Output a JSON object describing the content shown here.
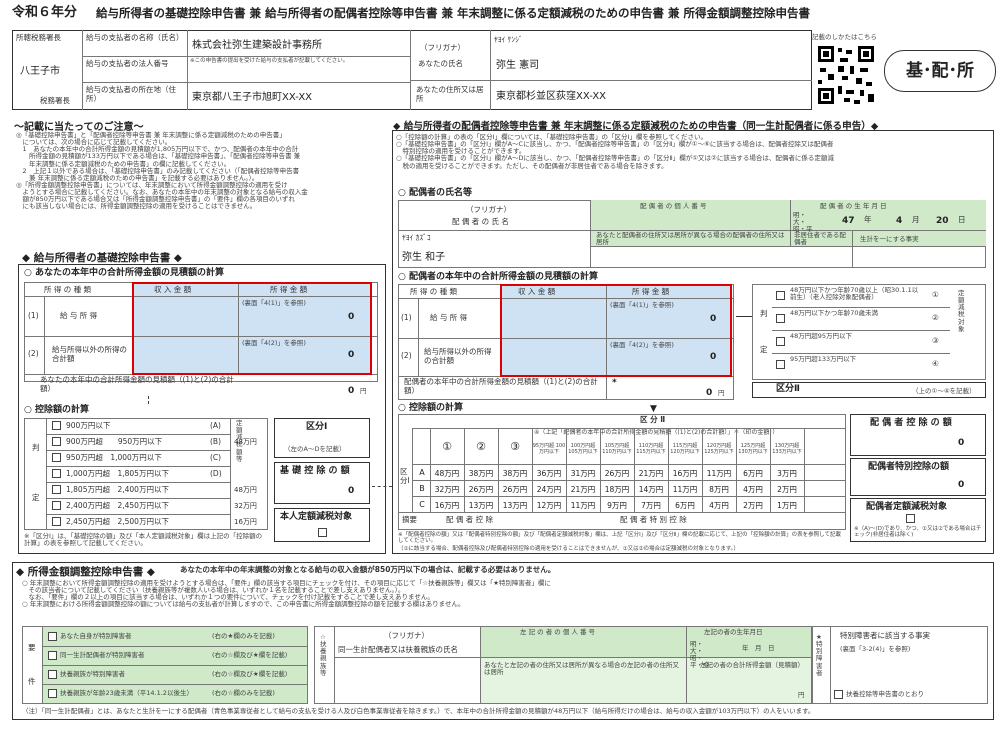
{
  "header": {
    "year": "令和６年分",
    "title": "給与所得者の基礎控除申告書 兼 給与所得者の配偶者控除等申告書 兼 年末調整に係る定額減税のための申告書 兼 所得金額調整控除申告書",
    "tax_office": "所轄税務署長",
    "tax_office_value": "八王子市",
    "tax_office_suffix": "税務署長",
    "payer_name_label": "給与の支払者の名称（氏名）",
    "payer_name": "株式会社弥生建築設計事務所",
    "payer_number_label": "給与の支払者の法人番号",
    "payer_number_note": "※この申告書の提出を受けた給与の支払者が記載してください。",
    "payer_address_label": "給与の支払者の所在地（住所）",
    "payer_address": "東京都八王子市旭町XX-XX",
    "furigana_label": "（フリガナ）",
    "name_label": "あなたの氏名",
    "furigana": "ﾔﾖｲ ｹﾝｼﾞ",
    "name": "弥生 憲司",
    "address_label": "あなたの住所又は居所",
    "address": "東京都杉並区荻窪XX-XX",
    "qr_caption": "記載のしかたはこちら",
    "badge": "基･配･所"
  },
  "notes": {
    "title": "～記載に当たってのご注意～",
    "lines": [
      "◎「基礎控除申告書」と「配偶者控除等申告書 兼 年末調整に係る定額減税のための申告書」",
      "　については、次の場合に応じて記載してください。",
      "　1　あなたの本年中の合計所得金額の見積額が1,805万円以下で、かつ、配偶者の本年中の合計",
      "　　所得金額の見積額が133万円以下である場合は、「基礎控除申告書」、「配偶者控除等申告書 兼",
      "　　年末調整に係る定額減税のための申告書」の欄に記載してください。",
      "　2　上記１以外である場合は、「基礎控除申告書」のみ記載してください（「配偶者控除等申告書",
      "　　兼 年末調整に係る定額減税のための申告書」を記載する必要はありません。）。",
      "◎「所得金額調整控除申告書」については、年末調整において所得金額調整控除の適用を受け",
      "　ようとする場合に記載してください。なお、あなたの本年中の年末調整の対象となる給与の収入金",
      "　額が850万円以下である場合又は「所得金額調整控除申告書」の「要件」欄の各項目のいずれ",
      "　にも該当しない場合には、所得金額調整控除の適用を受けることはできません。"
    ]
  },
  "basic": {
    "title": "◆ 給与所得者の基礎控除申告書 ◆",
    "income_section": "○ あなたの本年中の合計所得金額の見積額の計算",
    "col_type": "所 得 の 種 類",
    "col_revenue": "収 入 金 額",
    "col_income": "所 得 金 額",
    "row1_num": "(1)",
    "row1_label": "給 与 所 得",
    "row1_ref": "(裏面「4(1)」を参照)",
    "row1_value": "0",
    "row2_num": "(2)",
    "row2_label": "給与所得以外の所得の合計額",
    "row2_ref": "(裏面「4(2)」を参照)",
    "row2_value": "0",
    "total_label": "あなたの本年中の合計所得金額の見積額（(1)と(2)の合計額）",
    "total_value": "0",
    "yen": "円",
    "deduction_section": "○ 控除額の計算",
    "judge_top": "判",
    "judge_bottom": "定",
    "rows": [
      {
        "range": "900万円以下",
        "code": "(A)",
        "amt": ""
      },
      {
        "range": "900万円超　　950万円以下",
        "code": "(B)",
        "amt": "48万円"
      },
      {
        "range": "950万円超　1,000万円以下",
        "code": "(C)",
        "amt": ""
      },
      {
        "range": "1,000万円超　1,805万円以下",
        "code": "(D)",
        "amt": ""
      },
      {
        "range": "1,805万円超　2,400万円以下",
        "code": "",
        "amt": "48万円"
      },
      {
        "range": "2,400万円超　2,450万円以下",
        "code": "",
        "amt": "32万円"
      },
      {
        "range": "2,450万円超　2,500万円以下",
        "code": "",
        "amt": "16万円"
      }
    ],
    "col_reduction": "定額減税額等",
    "category_label": "区分Ⅰ",
    "category_note": "（左のA～Dを記載）",
    "basic_deduction_label": "基 礎 控 除 の 額",
    "basic_deduction_value": "0",
    "self_reduction_label": "本人定額減税対象",
    "footnote": "※「区分Ⅰ」は、「基礎控除の額」及び「本人定額減税対象」欄は上記の「控除額の計算」の表を参照して記載してください。"
  },
  "spouse": {
    "title": "◆ 給与所得者の配偶者控除等申告書 兼 年末調整に係る定額減税のための申告書（同一生計配偶者に係る申告）◆",
    "notes": [
      "○「控除額の計算」の表の「区分Ⅰ」欄については、「基礎控除申告書」の「区分Ⅰ」欄を参照してください。",
      "○「基礎控除申告書」の「区分Ⅰ」欄がA～Cに該当し、かつ、「配偶者控除等申告書」の「区分Ⅱ」欄が①～⑥に該当する場合は、配偶者控除又は配偶者",
      "　特別控除の適用を受けることができます。",
      "○「基礎控除申告書」の「区分Ⅰ」欄がA～Dに該当し、かつ、「配偶者控除等申告書」の「区分Ⅱ」欄が①又は②に該当する場合は、配偶者に係る定額減",
      "　税の適用を受けることができます。ただし、その配偶者が非居住者である場合を除きます。"
    ],
    "name_section": "○ 配偶者の氏名等",
    "furigana_label": "（フリガナ）",
    "name_label": "配 偶 者 の 氏 名",
    "personal_number_label": "配 偶 者 の 個 人 番 号",
    "birth_label": "配 偶 者 の 生 年 月 日",
    "era": "明・大・昭・平",
    "birth_year": "47",
    "year_unit": "年",
    "birth_month": "4",
    "month_unit": "月",
    "birth_day": "20",
    "day_unit": "日",
    "address_diff_label": "あなたと配偶者の住所又は居所が異なる場合の配偶者の住所又は居所",
    "nonresident_label": "非居住者である配偶者",
    "same_living_label": "生計を一にする事実",
    "furigana": "ﾔﾖｲ ｶｽﾞｺ",
    "name": "弥生 和子",
    "income_section": "○ 配偶者の本年中の合計所得金額の見積額の計算",
    "col_type": "所 得 の 種 類",
    "col_revenue": "収 入 金 額",
    "col_income": "所 得 金 額",
    "row1_num": "(1)",
    "row1_label": "給 与 所 得",
    "row1_ref": "(裏面「4(1)」を参照)",
    "row1_value": "0",
    "row2_num": "(2)",
    "row2_label": "給与所得以外の所得の合計額",
    "row2_ref": "(裏面「4(2)」を参照)",
    "row2_value": "0",
    "total_label": "配偶者の本年中の合計所得金額の見積額（(1)と(2)の合計額）",
    "total_mark": "*",
    "total_value": "0",
    "yen": "円",
    "judge_top": "判",
    "judge_bottom": "定",
    "judge_rows": [
      {
        "label": "48万円以下かつ年齢70歳以上（昭30.1.1以前生）（老人控除対象配偶者）",
        "code": "①"
      },
      {
        "label": "48万円以下かつ年齢70歳未満",
        "code": "②"
      },
      {
        "label": "48万円超95万円以下",
        "code": "③"
      },
      {
        "label": "95万円超133万円以下",
        "code": "④"
      }
    ],
    "judge_side": "定額減税対象",
    "category2_label": "区分Ⅱ",
    "category2_note": "（上の①～④を記載）",
    "deduction_section": "○ 控除額の計算",
    "table_category2": "区 分 Ⅱ",
    "col_heads": [
      "①",
      "②",
      "③"
    ],
    "col_head4": "④（上記「配偶者の本年中の合計所得金額の見積額（(1)と(2)の合計額）」＊（印の金額））",
    "sub_heads": [
      "95万円超 100万円以下",
      "100万円超 105万円以下",
      "105万円超 110万円以下",
      "110万円超 115万円以下",
      "115万円超 120万円以下",
      "120万円超 125万円以下",
      "125万円超 130万円以下",
      "130万円超 133万円以下"
    ],
    "side_label": "区分Ⅰ",
    "row_codes": [
      "A",
      "B",
      "C"
    ],
    "table": [
      [
        "48万円",
        "38万円",
        "38万円",
        "36万円",
        "31万円",
        "26万円",
        "21万円",
        "16万円",
        "11万円",
        "6万円",
        "3万円"
      ],
      [
        "32万円",
        "26万円",
        "26万円",
        "24万円",
        "21万円",
        "18万円",
        "14万円",
        "11万円",
        "8万円",
        "4万円",
        "2万円"
      ],
      [
        "16万円",
        "13万円",
        "13万円",
        "12万円",
        "11万円",
        "9万円",
        "7万円",
        "6万円",
        "4万円",
        "2万円",
        "1万円"
      ]
    ],
    "footer_left": "摘要",
    "footer_mid": "配 偶 者 控 除",
    "footer_right": "配 偶 者 特 別 控 除",
    "spouse_deduction_label": "配 偶 者 控 除 の 額",
    "spouse_deduction_value": "0",
    "spouse_special_label": "配偶者特別控除の額",
    "spouse_special_value": "0",
    "spouse_reduction_label": "配偶者定額減税対象",
    "reduction_note": "※（A)～(D)であり、かつ、①又は②である場合はチェック(非居住者は除く)",
    "footnote1": "※「配偶者控除の額」又は「配偶者特別控除の額」及び「配偶者定額減税対象」欄は、上記「区分Ⅰ」及び「区分Ⅱ」欄の記載に応じて、上記の「控除額の計算」の表を参照して記載してください。",
    "footnote2": "（①に該当する場合、配偶者控除及び配偶者特別控除の適用を受けることはできませんが、①又は②の場合は定額減税の対象となります。）"
  },
  "adjustment": {
    "title": "◆ 所得金額調整控除申告書 ◆",
    "subtitle": "あなたの本年中の年末調整の対象となる給与の収入金額が850万円以下の場合は、記載する必要はありません。",
    "notes": [
      "○ 年末調整において所得金額調整控除の適用を受けようとする場合は、「要件」欄の該当する項目にチェックを付け、その項目に応じて「☆扶養親族等」欄又は「★特別障害者」欄に",
      "　その該当者について記載してください（扶養親族等が複数人いる場合は、いずれか１名を記載することで差し支えありません。）。",
      "　なお、「要件」欄の２以上の項目に該当する場合は、いずれか１つの要件について、チェックを付け記載をすることで差し支えありません。",
      "○ 年末調整における所得金額調整控除の額については給与の支払者が計算しますので、この申告書に所得金額調整控除の額を記載する欄はありません。"
    ],
    "req_top": "要",
    "req_bottom": "件",
    "requirements": [
      {
        "label": "あなた自身が特別障害者",
        "note": "(右の★欄のみを記載)"
      },
      {
        "label": "同一生計配偶者が特別障害者",
        "note": "(右の☆欄及び★欄を記載)"
      },
      {
        "label": "扶養親族が特別障害者",
        "note": "(右の☆欄及び★欄を記載)"
      },
      {
        "label": "扶養親族が年齢23歳未満（平14.1.2以後生）",
        "note": "(右の☆欄のみを記載)"
      }
    ],
    "dependents_side": "☆扶養親族等",
    "furigana_label": "（フリガナ）",
    "dep_name_label": "同一生計配偶者又は扶養親族の氏名",
    "personal_number_label": "左 記 の 者 の 個 人 番 号",
    "birth_label": "左記の者の生年月日",
    "era": "明・大・昭・平・令",
    "ymd": "年　月　日",
    "address_diff_label": "あなたと左記の者の住所又は居所が異なる場合の左記の者の住所又は居所",
    "income_label": "左記の者の合計所得金額（見積額）",
    "income_yen": "円",
    "special_side": "★特別障害者",
    "special_label": "特別障害者に該当する事実",
    "special_ref": "(裏面「3-2(4)」を参照)",
    "special_check": "扶養控除等申告書のとおり"
  },
  "footer_note": "（注）「同一生計配偶者」とは、あなたと生計を一にする配偶者（青色事業専従者として給与の支払を受ける人及び白色事業専従者を除きます。）で、本年中の合計所得金額の見積額が48万円以下（給与所得だけの場合は、給与の収入金額が103万円以下）の人をいいます。",
  "colors": {
    "blue": "#cfe2f3",
    "green": "#cfe9c9",
    "red": "#dd0000"
  }
}
